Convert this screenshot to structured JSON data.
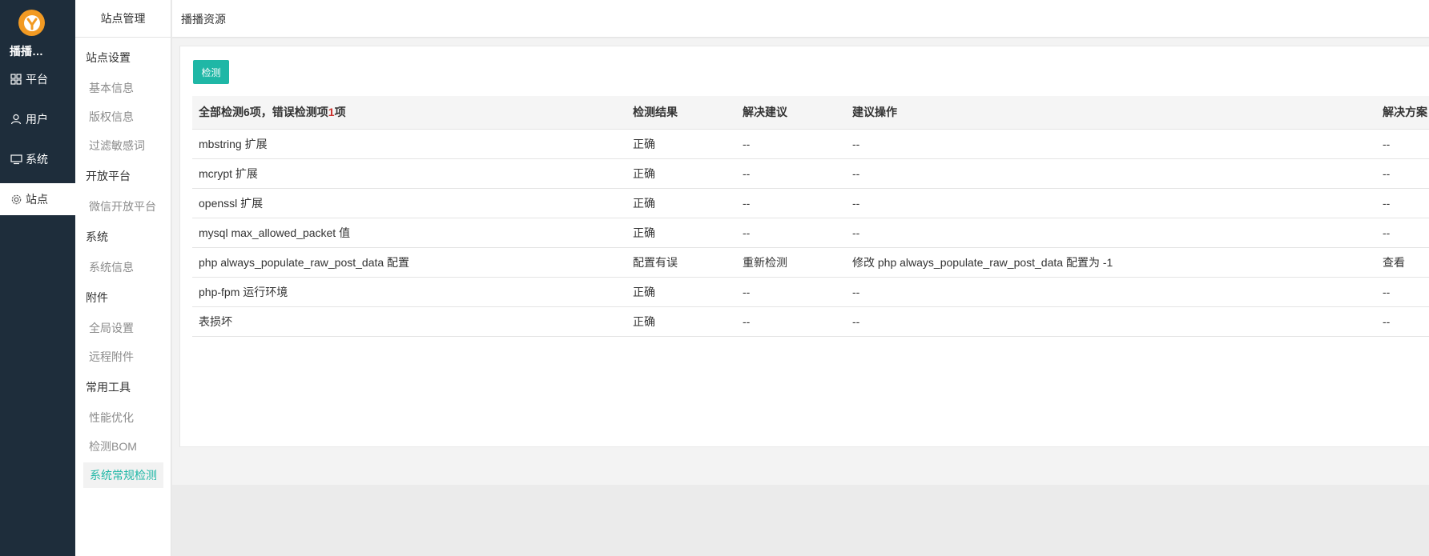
{
  "rail": {
    "site_name": "播播…",
    "items": [
      {
        "label": "平台",
        "icon": "grid-icon"
      },
      {
        "label": "用户",
        "icon": "user-icon"
      },
      {
        "label": "系统",
        "icon": "monitor-icon"
      },
      {
        "label": "站点",
        "icon": "gear-icon",
        "active": true
      }
    ]
  },
  "submenu": {
    "title": "站点管理",
    "groups": [
      {
        "label": "站点设置",
        "items": [
          "基本信息",
          "版权信息",
          "过滤敏感词"
        ]
      },
      {
        "label": "开放平台",
        "items": [
          "微信开放平台"
        ]
      },
      {
        "label": "系统",
        "items": [
          "系统信息"
        ]
      },
      {
        "label": "附件",
        "items": [
          "全局设置",
          "远程附件"
        ]
      },
      {
        "label": "常用工具",
        "items": [
          "性能优化",
          "检测BOM",
          "系统常规检测"
        ]
      }
    ],
    "active_item": "系统常规检测"
  },
  "topbar": {
    "breadcrumb": "播播资源"
  },
  "main": {
    "check_button": "检测",
    "summary": {
      "prefix": "全部检测6项，错误检测项",
      "error_count": "1",
      "suffix": "项"
    },
    "columns": [
      "检测结果",
      "解决建议",
      "建议操作",
      "解决方案"
    ],
    "rows": [
      {
        "name": "mbstring 扩展",
        "result": "正确",
        "status": "ok",
        "advice": "--",
        "action": "--",
        "solution": "--"
      },
      {
        "name": "mcrypt 扩展",
        "result": "正确",
        "status": "ok",
        "advice": "--",
        "action": "--",
        "solution": "--"
      },
      {
        "name": "openssl 扩展",
        "result": "正确",
        "status": "ok",
        "advice": "--",
        "action": "--",
        "solution": "--"
      },
      {
        "name": "mysql max_allowed_packet 值",
        "result": "正确",
        "status": "ok",
        "advice": "--",
        "action": "--",
        "solution": "--"
      },
      {
        "name": "php always_populate_raw_post_data 配置",
        "result": "配置有误",
        "status": "error",
        "advice": "重新检测",
        "action": "修改 php always_populate_raw_post_data 配置为 -1",
        "solution": "查看"
      },
      {
        "name": "php-fpm 运行环境",
        "result": "正确",
        "status": "ok",
        "advice": "--",
        "action": "--",
        "solution": "--"
      },
      {
        "name": "表损坏",
        "result": "正确",
        "status": "ok",
        "advice": "--",
        "action": "--",
        "solution": "--"
      }
    ]
  },
  "colors": {
    "rail_bg": "#1e2d3b",
    "accent": "#1fb7a6",
    "error": "#c9302c",
    "link": "#2c6a9a",
    "logo": "#f29a23"
  }
}
